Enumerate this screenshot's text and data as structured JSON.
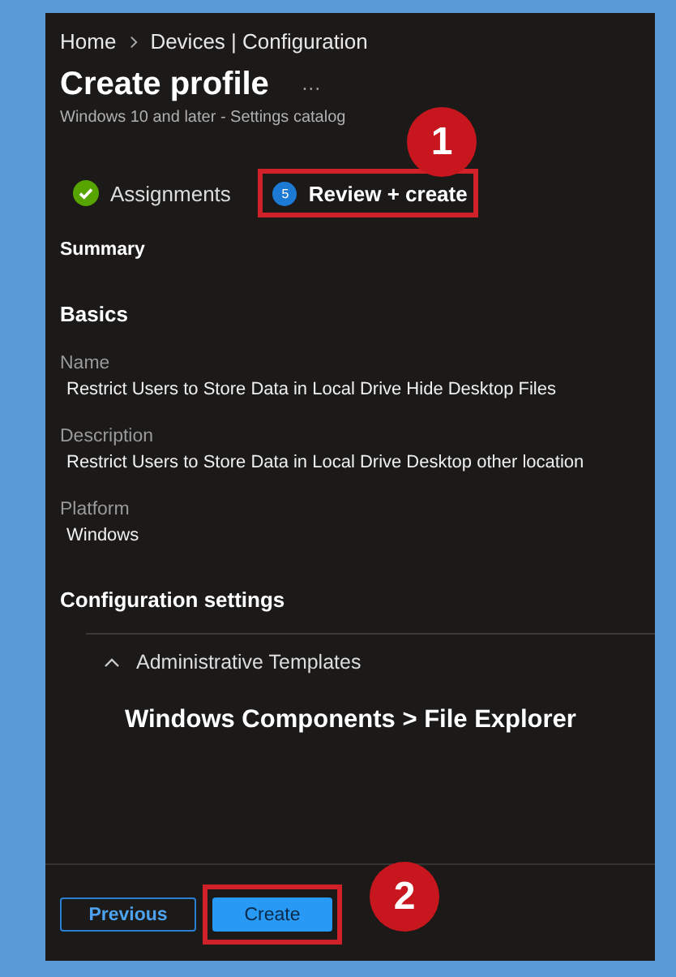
{
  "breadcrumb": [
    {
      "label": "Home"
    },
    {
      "label": "Devices | Configuration"
    }
  ],
  "title": "Create profile",
  "more": "···",
  "subtitle": "Windows 10 and later - Settings catalog",
  "steps": [
    {
      "label": "Assignments",
      "kind": "done",
      "selected": false,
      "highlighted": false
    },
    {
      "label": "Review + create",
      "kind": "numbered",
      "number": "5",
      "selected": true,
      "highlighted": true
    }
  ],
  "summary": {
    "heading": "Summary",
    "section": "Basics",
    "fields": [
      {
        "label": "Name",
        "value": "Restrict Users to Store Data in Local Drive Hide Desktop Files"
      },
      {
        "label": "Description",
        "value": "Restrict Users to Store Data in Local Drive Desktop other location"
      },
      {
        "label": "Platform",
        "value": "Windows"
      }
    ]
  },
  "config": {
    "heading": "Configuration settings",
    "group": {
      "label": "Administrative Templates",
      "expanded": true
    },
    "category": "Windows Components > File Explorer"
  },
  "buttons": [
    {
      "label": "Previous",
      "kind": "secondary",
      "highlighted": false
    },
    {
      "label": "Create",
      "kind": "primary",
      "highlighted": true
    }
  ],
  "annotations": [
    {
      "number": "1"
    },
    {
      "number": "2"
    }
  ]
}
